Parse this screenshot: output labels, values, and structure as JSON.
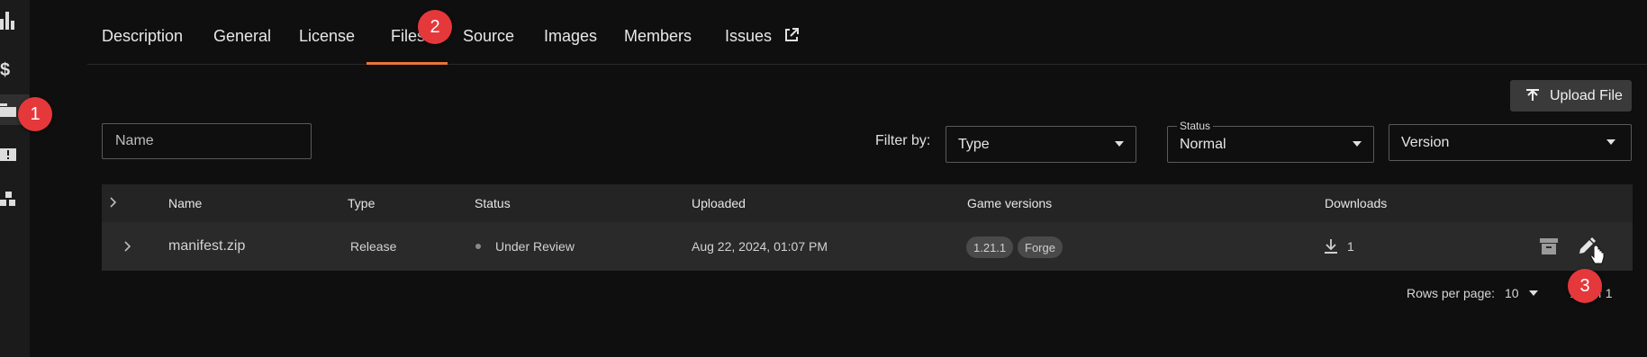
{
  "tabs": [
    {
      "label": "Description"
    },
    {
      "label": "General"
    },
    {
      "label": "License"
    },
    {
      "label": "Files",
      "active": true
    },
    {
      "label": "Source"
    },
    {
      "label": "Images"
    },
    {
      "label": "Members"
    },
    {
      "label": "Issues"
    }
  ],
  "upload_button": {
    "label": "Upload File",
    "icon": "upload-icon"
  },
  "filters": {
    "name_placeholder": "Name",
    "filter_by_label": "Filter by:",
    "type": {
      "value": "Type"
    },
    "status": {
      "legend": "Status",
      "value": "Normal"
    },
    "version": {
      "value": "Version"
    }
  },
  "table": {
    "columns": [
      "Name",
      "Type",
      "Status",
      "Uploaded",
      "Game versions",
      "Downloads"
    ],
    "rows": [
      {
        "name": "manifest.zip",
        "type": "Release",
        "status": "Under Review",
        "uploaded": "Aug 22, 2024, 01:07 PM",
        "game_versions": [
          "1.21.1",
          "Forge"
        ],
        "downloads": "1"
      }
    ]
  },
  "pagination": {
    "rows_per_page_label": "Rows per page:",
    "rows_per_page_value": "10",
    "range": "1-1 of 1"
  },
  "annotations": {
    "badge1": "1",
    "badge2": "2",
    "badge3": "3"
  },
  "colors": {
    "background": "#0f0f0f",
    "accent_underline": "#e9743c",
    "badge": "#e5383b"
  }
}
